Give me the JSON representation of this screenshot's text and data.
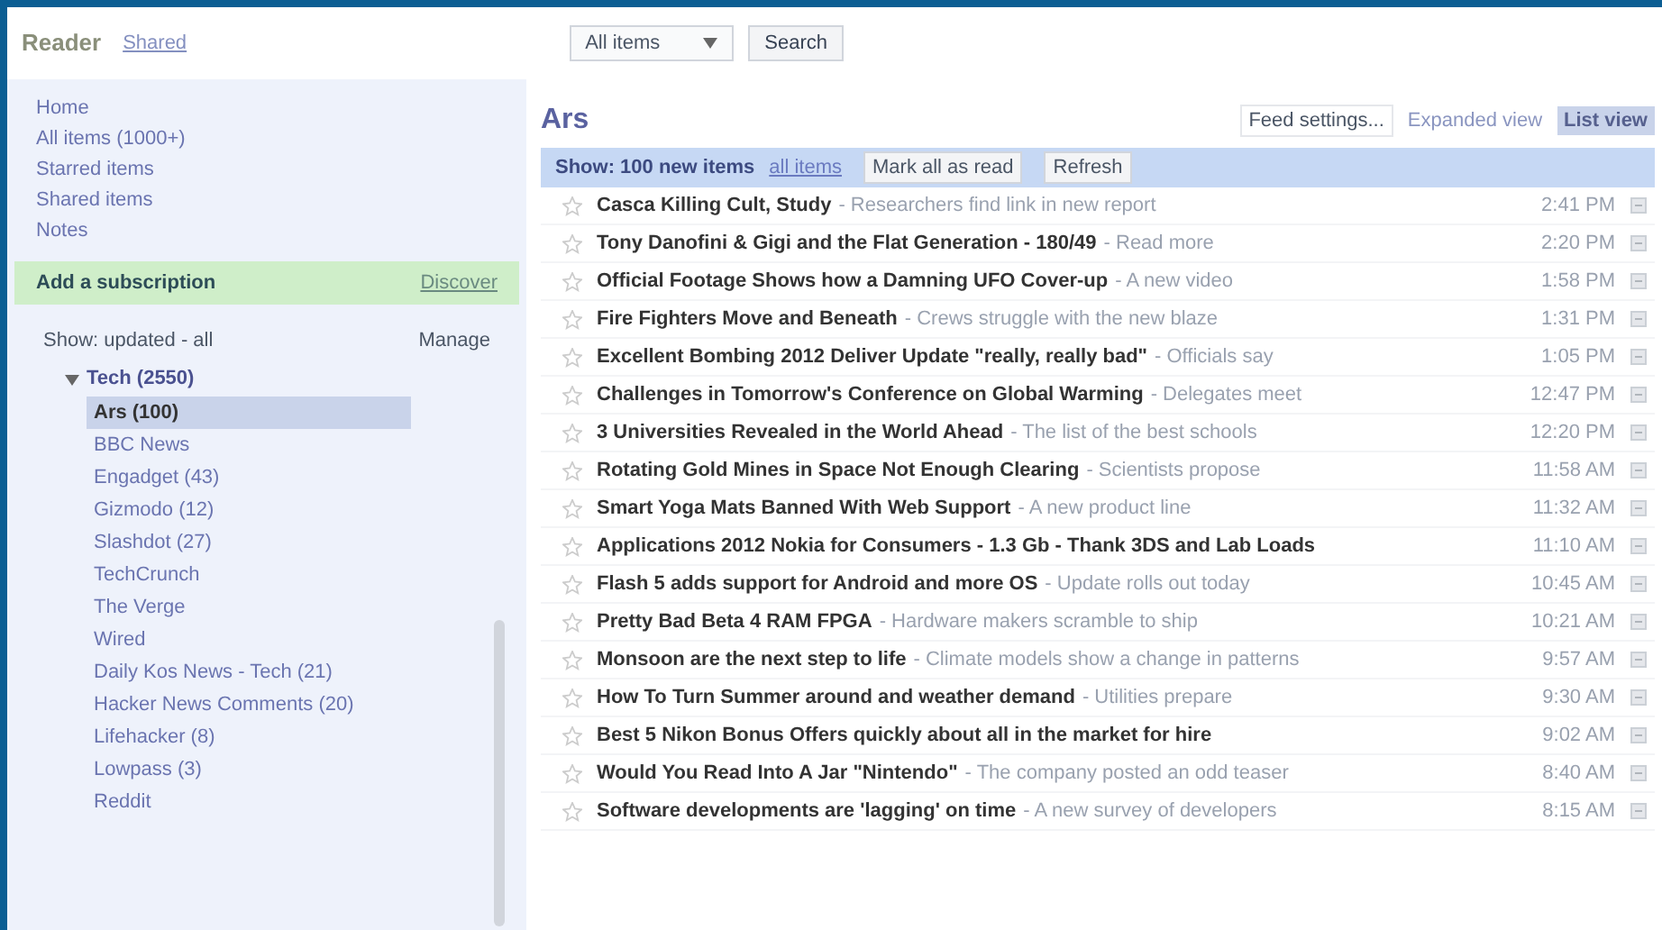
{
  "header": {
    "logo": "Reader",
    "links": [
      "Shared"
    ],
    "search": {
      "scope": "All items",
      "button": "Search"
    }
  },
  "sidebar": {
    "nav": [
      {
        "label": "Home",
        "selected": false
      },
      {
        "label": "All items (1000+)",
        "selected": false
      },
      {
        "label": "Starred items",
        "selected": false
      },
      {
        "label": "Shared items",
        "selected": false
      },
      {
        "label": "Notes",
        "selected": false
      }
    ],
    "add_button": "Add a subscription",
    "discover": "Discover",
    "subscriptions_header": "Show: updated - all",
    "manage": "Manage",
    "tree": [
      {
        "label": "Tech (2550)",
        "expanded": true,
        "children": [
          {
            "label": "Ars (100)",
            "selected": true
          },
          {
            "label": "BBC News",
            "selected": false
          },
          {
            "label": "Engadget (43)",
            "selected": false
          },
          {
            "label": "Gizmodo (12)",
            "selected": false
          },
          {
            "label": "Slashdot (27)",
            "selected": false
          },
          {
            "label": "TechCrunch",
            "selected": false
          },
          {
            "label": "The Verge",
            "selected": false
          },
          {
            "label": "Wired",
            "selected": false
          },
          {
            "label": "Daily Kos News - Tech (21)",
            "selected": false
          },
          {
            "label": "Hacker News Comments (20)",
            "selected": false
          },
          {
            "label": "Lifehacker (8)",
            "selected": false
          },
          {
            "label": "Lowpass (3)",
            "selected": false
          },
          {
            "label": "Reddit",
            "selected": false
          }
        ]
      }
    ]
  },
  "feed": {
    "title": "Ars",
    "settings": "Feed settings...",
    "expand": "Expanded view",
    "list_view": "List view",
    "toolbar": [
      {
        "label": "Show: 100 new items",
        "selected": true
      },
      {
        "label": "all items",
        "selected": false
      }
    ],
    "mark_all": "Mark all as read",
    "refresh": "Refresh",
    "items": [
      {
        "title": "Casca Killing Cult, Study",
        "snippet": "- Researchers find link in new report",
        "date": "2:41 PM",
        "starred": false
      },
      {
        "title": "Tony Danofini & Gigi and the Flat Generation - 180/49",
        "snippet": "- Read more",
        "date": "2:20 PM",
        "starred": false
      },
      {
        "title": "Official Footage Shows how a Damning UFO Cover-up",
        "snippet": "- A new video",
        "date": "1:58 PM",
        "starred": false
      },
      {
        "title": "Fire Fighters Move and Beneath",
        "snippet": "- Crews struggle with the new blaze",
        "date": "1:31 PM",
        "starred": false
      },
      {
        "title": "Excellent Bombing 2012 Deliver Update \"really, really bad\"",
        "snippet": "- Officials say",
        "date": "1:05 PM",
        "starred": false
      },
      {
        "title": "Challenges in Tomorrow's Conference on Global Warming",
        "snippet": "- Delegates meet",
        "date": "12:47 PM",
        "starred": false
      },
      {
        "title": "3 Universities Revealed in the World Ahead",
        "snippet": "- The list of the best schools",
        "date": "12:20 PM",
        "starred": false
      },
      {
        "title": "Rotating Gold Mines in Space Not Enough Clearing",
        "snippet": "- Scientists propose",
        "date": "11:58 AM",
        "starred": false
      },
      {
        "title": "Smart Yoga Mats Banned With Web Support",
        "snippet": "- A new product line",
        "date": "11:32 AM",
        "starred": false
      },
      {
        "title": "Applications 2012 Nokia for Consumers - 1.3 Gb - Thank 3DS and Lab Loads",
        "date": "11:10 AM",
        "starred": false
      },
      {
        "title": "Flash 5 adds support for Android and more OS",
        "snippet": "- Update rolls out today",
        "date": "10:45 AM",
        "starred": false
      },
      {
        "title": "Pretty Bad Beta 4 RAM FPGA",
        "snippet": "- Hardware makers scramble to ship",
        "date": "10:21 AM",
        "starred": false
      },
      {
        "title": "Monsoon are the next step to life",
        "snippet": "- Climate models show a change in patterns",
        "date": "9:57 AM",
        "starred": false
      },
      {
        "title": "How To Turn Summer around and weather demand",
        "snippet": "- Utilities prepare",
        "date": "9:30 AM",
        "starred": false
      },
      {
        "title": "Best 5 Nikon Bonus Offers quickly about all in the market for hire",
        "date": "9:02 AM",
        "starred": false
      },
      {
        "title": "Would You Read Into A Jar \"Nintendo\"",
        "snippet": "- The company posted an odd teaser",
        "date": "8:40 AM",
        "starred": false
      },
      {
        "title": "Software developments are 'lagging' on time",
        "snippet": "- A new survey of developers",
        "date": "8:15 AM",
        "starred": false
      }
    ]
  }
}
